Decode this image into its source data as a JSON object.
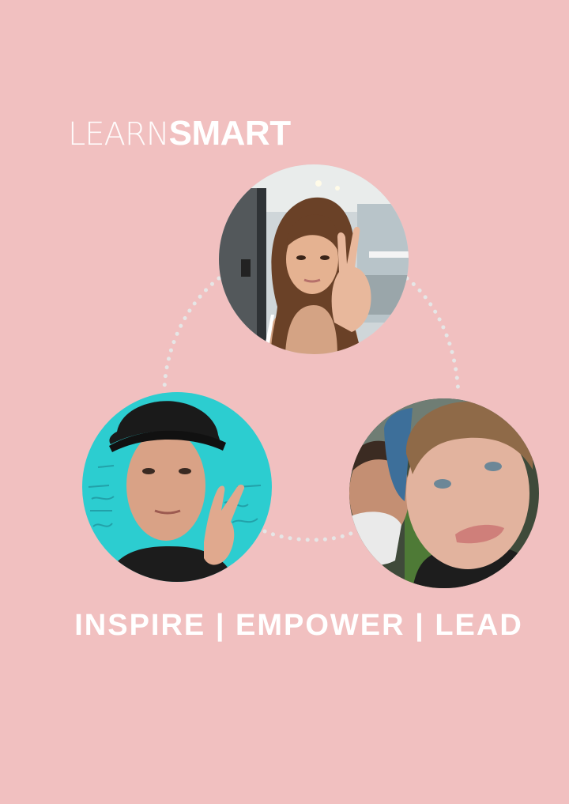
{
  "brand": {
    "logo_light": "LEARN",
    "logo_bold": "SMART"
  },
  "tagline": "INSPIRE | EMPOWER | LEAD",
  "colors": {
    "background": "#f1c0c0",
    "text": "#ffffff",
    "connector": "#e6e6e6",
    "left_photo_background": "#2ccdd0"
  }
}
